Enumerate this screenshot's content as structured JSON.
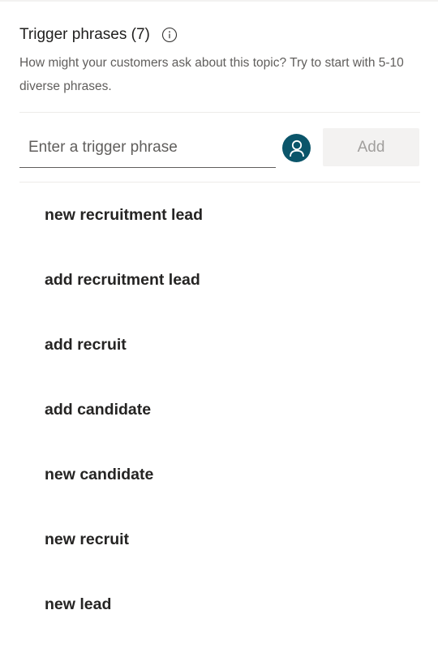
{
  "section": {
    "title": "Trigger phrases (7)",
    "info_icon": "info-icon",
    "description": "How might your customers ask about this topic? Try to start with 5-10 diverse phrases."
  },
  "input": {
    "placeholder": "Enter a trigger phrase",
    "value": ""
  },
  "avatar": {
    "icon": "person-icon",
    "color": "#0b556a"
  },
  "add_button": {
    "label": "Add",
    "enabled": false
  },
  "phrases": [
    "new recruitment lead",
    "add recruitment lead",
    "add recruit",
    "add candidate",
    "new candidate",
    "new recruit",
    "new lead"
  ]
}
